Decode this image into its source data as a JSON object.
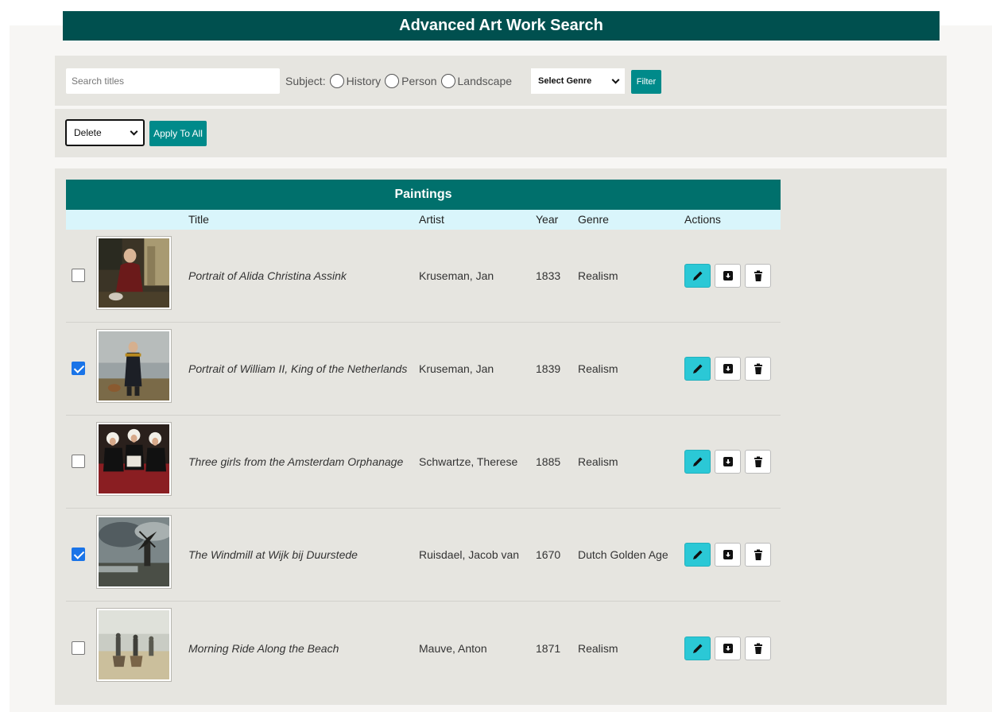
{
  "header": {
    "title": "Advanced Art Work Search"
  },
  "filters": {
    "search_placeholder": "Search titles",
    "search_value": "",
    "subject_label": "Subject:",
    "subject_options": [
      "History",
      "Person",
      "Landscape"
    ],
    "genre_select_value": "Select Genre",
    "filter_button": "Filter"
  },
  "bulk": {
    "action_value": "Delete",
    "apply_button": "Apply To All"
  },
  "table": {
    "title": "Paintings",
    "columns": {
      "title": "Title",
      "artist": "Artist",
      "year": "Year",
      "genre": "Genre",
      "actions": "Actions"
    },
    "rows": [
      {
        "checked": false,
        "title": "Portrait of Alida Christina Assink",
        "artist": "Kruseman, Jan",
        "year": "1833",
        "genre": "Realism"
      },
      {
        "checked": true,
        "title": "Portrait of William II, King of the Netherlands",
        "artist": "Kruseman, Jan",
        "year": "1839",
        "genre": "Realism"
      },
      {
        "checked": false,
        "title": "Three girls from the Amsterdam Orphanage",
        "artist": "Schwartze, Therese",
        "year": "1885",
        "genre": "Realism"
      },
      {
        "checked": true,
        "title": "The Windmill at Wijk bij Duurstede",
        "artist": "Ruisdael, Jacob van",
        "year": "1670",
        "genre": "Dutch Golden Age"
      },
      {
        "checked": false,
        "title": "Morning Ride Along the Beach",
        "artist": "Mauve, Anton",
        "year": "1871",
        "genre": "Realism"
      }
    ]
  },
  "icons": {
    "edit": "pencil-icon",
    "archive": "archive-icon",
    "delete": "trash-icon",
    "select_chevron": "chevron-down-icon"
  },
  "colors": {
    "header_bg": "#00504f",
    "table_title_bg": "#00706c",
    "button_teal": "#008a8a",
    "edit_button": "#2bc8d6",
    "table_head_bg": "#d9f5fb",
    "checkbox_checked": "#1a74e8"
  }
}
